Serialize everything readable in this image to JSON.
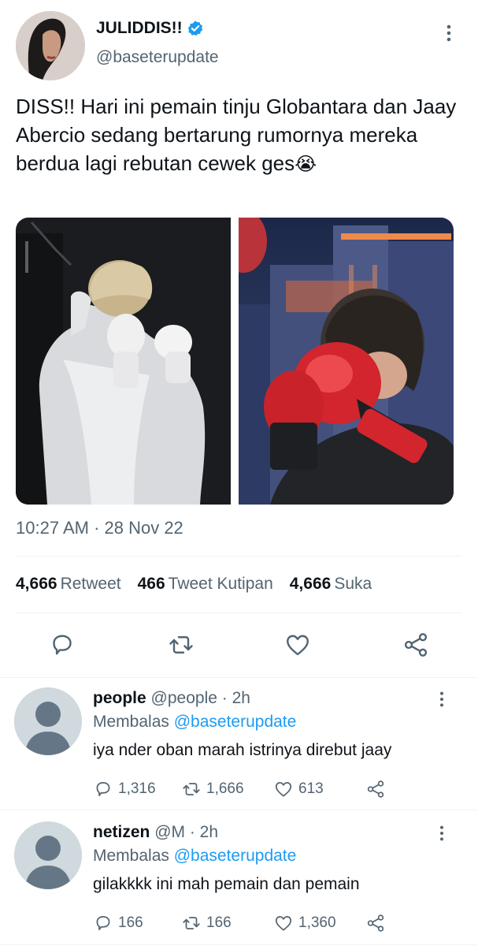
{
  "tweet": {
    "display_name": "JULIDDIS!!",
    "handle": "@baseterupdate",
    "text": "DISS!! Hari ini pemain tinju Globantara dan Jaay Abercio sedang bertarung rumornya mereka berdua lagi rebutan cewek ges",
    "emoji": "😭",
    "timestamp": "10:27 AM · 28 Nov 22",
    "verified": true
  },
  "stats": [
    {
      "count": "4,666",
      "label": "Retweet"
    },
    {
      "count": "466",
      "label": "Tweet Kutipan"
    },
    {
      "count": "4,666",
      "label": "Suka"
    }
  ],
  "replies": [
    {
      "name": "people",
      "meta": "@people · 2h",
      "replying_prefix": "Membalas",
      "replying_to": "@baseterupdate",
      "text": "iya nder oban marah istrinya direbut jaay",
      "reply_count": "1,316",
      "retweet_count": "1,666",
      "like_count": "613"
    },
    {
      "name": "netizen",
      "meta": "@M · 2h",
      "replying_prefix": "Membalas",
      "replying_to": "@baseterupdate",
      "text": "gilakkkk ini mah pemain dan pemain",
      "reply_count": "166",
      "retweet_count": "166",
      "like_count": "1,360"
    }
  ],
  "icons": {
    "verified": "verified-badge-icon",
    "more": "more-vertical-icon",
    "reply": "reply-bubble-icon",
    "retweet": "retweet-icon",
    "like": "heart-icon",
    "share": "share-icon"
  },
  "colors": {
    "accent": "#1d9bf0",
    "text": "#0f1419",
    "muted": "#536471",
    "divider": "#eff3f4"
  }
}
